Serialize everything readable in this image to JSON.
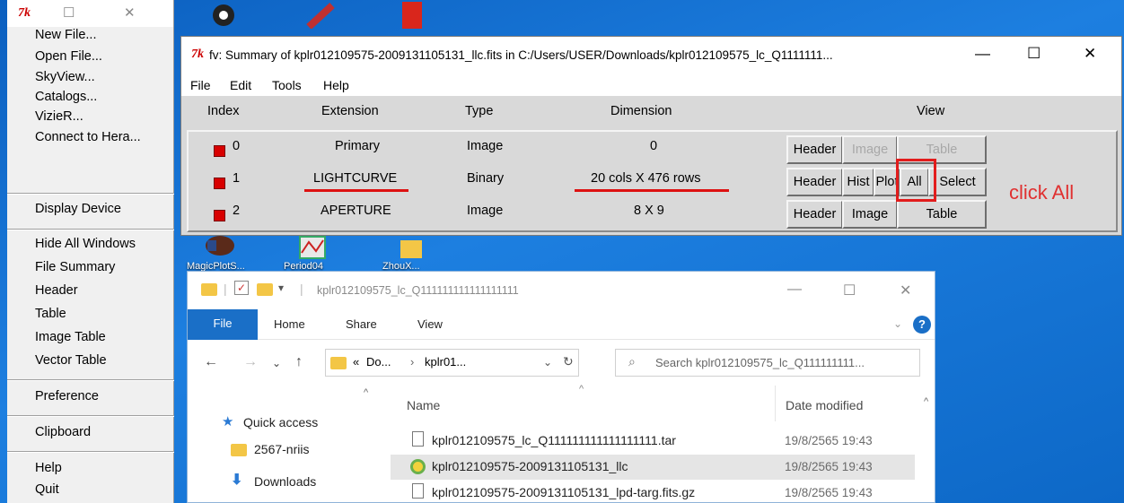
{
  "fv_main": {
    "logo": "7k",
    "menu": [
      "New File...",
      "Open File...",
      "SkyView...",
      "Catalogs...",
      "VizieR...",
      "Connect to Hera...",
      "Display Device",
      "Hide All Windows",
      "File Summary",
      "Header",
      "Table",
      "Image Table",
      "Vector Table",
      "Preference",
      "Clipboard",
      "Help",
      "Quit"
    ]
  },
  "summary": {
    "title": "fv: Summary of kplr012109575-2009131105131_llc.fits in C:/Users/USER/Downloads/kplr012109575_lc_Q1111111...",
    "menus": [
      "File",
      "Edit",
      "Tools",
      "Help"
    ],
    "columns": [
      "Index",
      "Extension",
      "Type",
      "Dimension",
      "View"
    ],
    "rows": [
      {
        "index": "0",
        "extension": "Primary",
        "type": "Image",
        "dimension": "0",
        "buttons": [
          "Header",
          "Image",
          "Table"
        ]
      },
      {
        "index": "1",
        "extension": "LIGHTCURVE",
        "type": "Binary",
        "dimension": "20 cols X 476 rows",
        "buttons": [
          "Header",
          "Hist",
          "Plot",
          "All",
          "Select"
        ]
      },
      {
        "index": "2",
        "extension": "APERTURE",
        "type": "Image",
        "dimension": "8 X 9",
        "buttons": [
          "Header",
          "Image",
          "Table"
        ]
      }
    ],
    "annotation": "click All"
  },
  "desktop": {
    "icons": [
      "MagicPlotS...",
      "Period04",
      "ZhouX..."
    ]
  },
  "explorer": {
    "path": "kplr012109575_lc_Q111111111111111111",
    "tabs": [
      "File",
      "Home",
      "Share",
      "View"
    ],
    "address": [
      "«",
      "Do...",
      "›",
      "kplr01..."
    ],
    "search_placeholder": "Search kplr012109575_lc_Q111111111...",
    "nav": [
      "Quick access",
      "2567-nriis",
      "Downloads"
    ],
    "headers": {
      "name": "Name",
      "date": "Date modified"
    },
    "files": [
      {
        "name": "kplr012109575_lc_Q111111111111111111.tar",
        "date": "19/8/2565 19:43"
      },
      {
        "name": "kplr012109575-2009131105131_llc",
        "date": "19/8/2565 19:43"
      },
      {
        "name": "kplr012109575-2009131105131_lpd-targ.fits.gz",
        "date": "19/8/2565 19:43"
      }
    ]
  },
  "colors": {
    "accent_red": "#e21c1c",
    "explorer_blue": "#1a6fc7",
    "panel_gray": "#d9d9d9"
  }
}
